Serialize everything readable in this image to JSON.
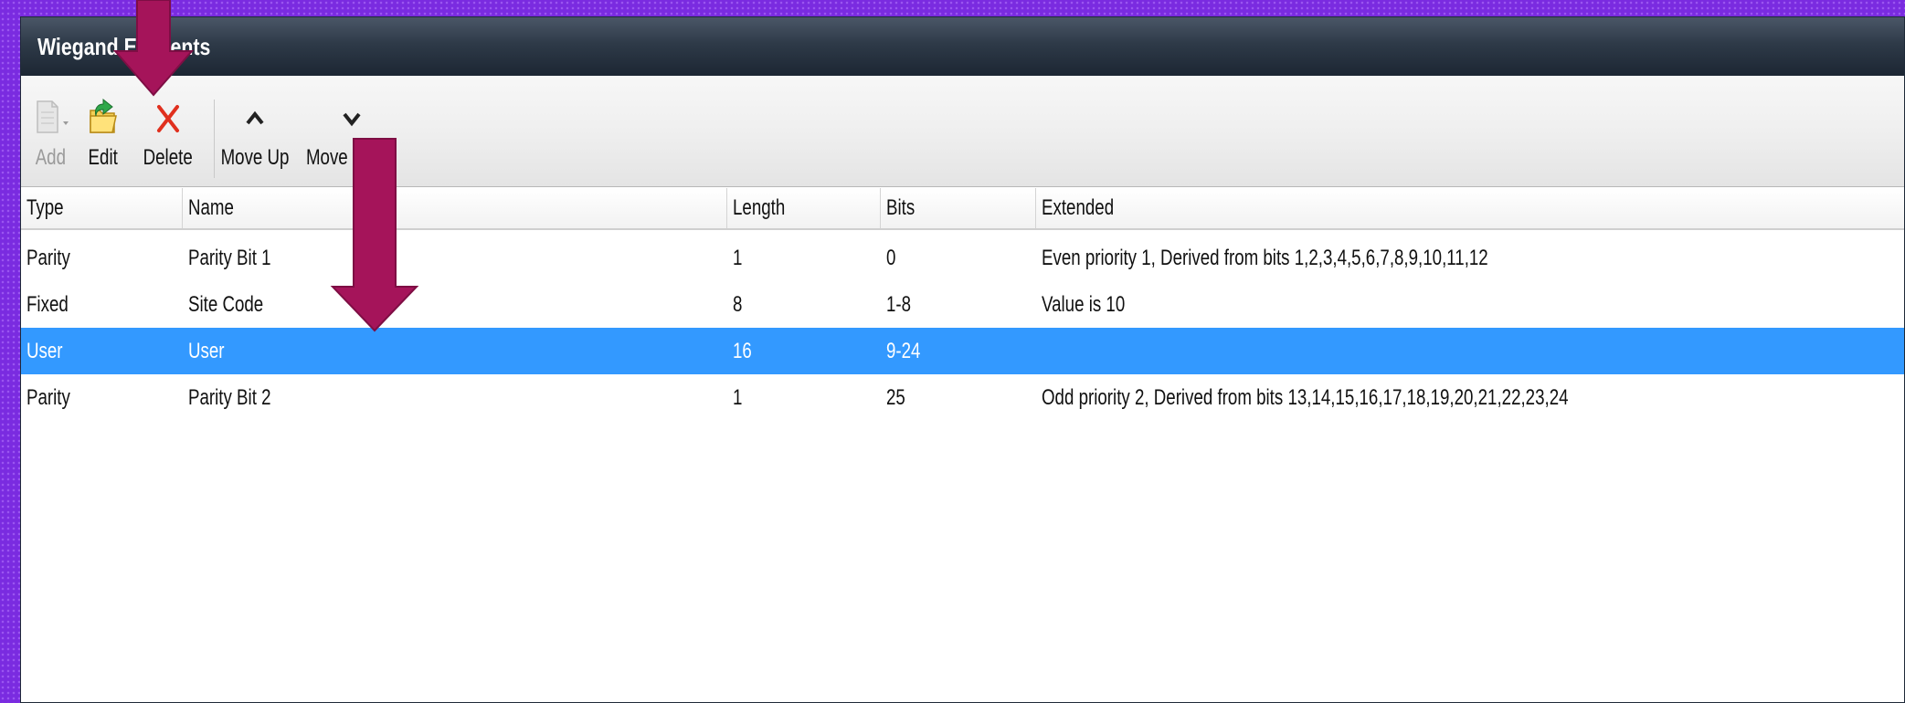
{
  "window": {
    "title": "Wiegand Elements"
  },
  "toolbar": {
    "add_label": "Add",
    "edit_label": "Edit",
    "delete_label": "Delete",
    "move_up_label": "Move Up",
    "move_down_label": "Move Down"
  },
  "grid": {
    "columns": [
      "Type",
      "Name",
      "Length",
      "Bits",
      "Extended"
    ],
    "rows": [
      {
        "type": "Parity",
        "name": "Parity Bit 1",
        "length": "1",
        "bits": "0",
        "extended": "Even priority 1, Derived from bits 1,2,3,4,5,6,7,8,9,10,11,12"
      },
      {
        "type": "Fixed",
        "name": "Site Code",
        "length": "8",
        "bits": "1-8",
        "extended": "Value is 10"
      },
      {
        "type": "User",
        "name": "User",
        "length": "16",
        "bits": "9-24",
        "extended": ""
      },
      {
        "type": "Parity",
        "name": "Parity Bit 2",
        "length": "1",
        "bits": "25",
        "extended": "Odd priority 2, Derived from bits 13,14,15,16,17,18,19,20,21,22,23,24"
      }
    ],
    "selected_row": 3
  },
  "colors": {
    "selection": "#3399ff",
    "arrow": "#a5145a",
    "delete_icon": "#e0301e",
    "background": "#7a2be0"
  },
  "icons": {
    "add": "document-add-icon",
    "edit": "folder-edit-icon",
    "delete": "red-x-icon",
    "move_up": "chevron-up-icon",
    "move_down": "chevron-down-icon"
  }
}
